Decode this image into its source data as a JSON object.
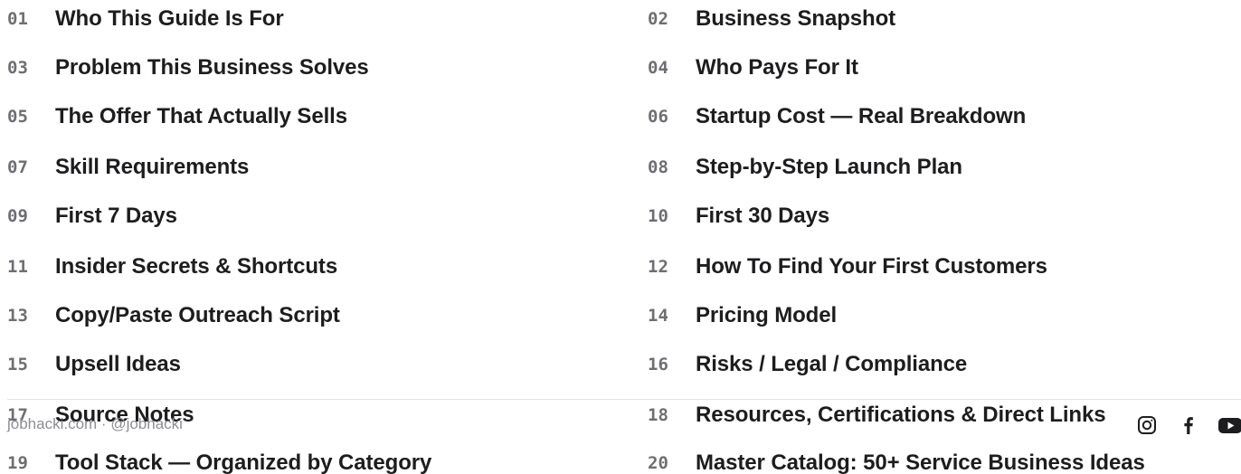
{
  "toc": {
    "items": [
      {
        "num": "01",
        "title": "Who This Guide Is For"
      },
      {
        "num": "02",
        "title": "Business Snapshot"
      },
      {
        "num": "03",
        "title": "Problem This Business Solves"
      },
      {
        "num": "04",
        "title": "Who Pays For It"
      },
      {
        "num": "05",
        "title": "The Offer That Actually Sells"
      },
      {
        "num": "06",
        "title": "Startup Cost — Real Breakdown"
      },
      {
        "num": "07",
        "title": "Skill Requirements"
      },
      {
        "num": "08",
        "title": "Step-by-Step Launch Plan"
      },
      {
        "num": "09",
        "title": "First 7 Days"
      },
      {
        "num": "10",
        "title": "First 30 Days"
      },
      {
        "num": "11",
        "title": "Insider Secrets & Shortcuts"
      },
      {
        "num": "12",
        "title": "How To Find Your First Customers"
      },
      {
        "num": "13",
        "title": "Copy/Paste Outreach Script"
      },
      {
        "num": "14",
        "title": "Pricing Model"
      },
      {
        "num": "15",
        "title": "Upsell Ideas"
      },
      {
        "num": "16",
        "title": "Risks / Legal / Compliance"
      },
      {
        "num": "17",
        "title": "Source Notes"
      },
      {
        "num": "18",
        "title": "Resources, Certifications & Direct Links"
      },
      {
        "num": "19",
        "title": "Tool Stack — Organized by Category"
      },
      {
        "num": "20",
        "title": "Master Catalog: 50+ Service Business Ideas"
      }
    ]
  },
  "footer": {
    "text": "jobhacki.com · @jobhacki",
    "social": [
      {
        "icon": "instagram-icon"
      },
      {
        "icon": "facebook-icon"
      },
      {
        "icon": "youtube-icon"
      }
    ]
  }
}
